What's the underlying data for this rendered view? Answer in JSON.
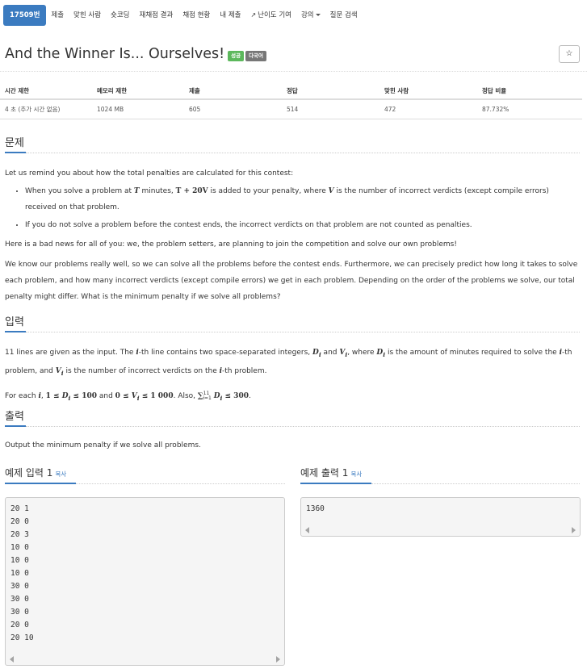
{
  "nav": {
    "items": [
      "17509번",
      "제출",
      "맞힌 사람",
      "숏코딩",
      "재채점 결과",
      "채점 현황",
      "내 제출",
      "난이도 기여",
      "강의",
      "질문 검색"
    ]
  },
  "problem": {
    "title": "And the Winner Is... Ourselves!",
    "badge_success": "성공",
    "badge_multilang": "다국어",
    "star": "☆"
  },
  "info": {
    "headers": [
      "시간 제한",
      "메모리 제한",
      "제출",
      "정답",
      "맞힌 사람",
      "정답 비율"
    ],
    "values": [
      "4 초 (추가 시간 없음)",
      "1024 MB",
      "605",
      "514",
      "472",
      "87.732%"
    ]
  },
  "sections": {
    "problem": "문제",
    "input": "입력",
    "output": "출력"
  },
  "statement": {
    "intro": "Let us remind you about how the total penalties are calculated for this contest:",
    "bullet1_a": "When you solve a problem at ",
    "bullet1_T": "T",
    "bullet1_b": " minutes, ",
    "bullet1_formula": "T + 20V",
    "bullet1_c": " is added to your penalty, where ",
    "bullet1_V": "V",
    "bullet1_d": " is the number of incorrect verdicts (except compile errors) received on that problem.",
    "bullet2": "If you do not solve a problem before the contest ends, the incorrect verdicts on that problem are not counted as penalties.",
    "para2": "Here is a bad news for all of you: we, the problem setters, are planning to join the competition and solve our own problems!",
    "para3": "We know our problems really well, so we can solve all the problems before the contest ends. Furthermore, we can precisely predict how long it takes to solve each problem, and how many incorrect verdicts (except compile errors) we get in each problem. Depending on the order of the problems we solve, our total penalty might differ. What is the minimum penalty if we solve all problems?"
  },
  "input_desc": {
    "line1_a": "11 lines are given as the input. The ",
    "line1_i": "i",
    "line1_b": "-th line contains two space-separated integers, ",
    "line1_D": "D",
    "line1_c": " and ",
    "line1_V": "V",
    "line1_d": ", where ",
    "line1_e": " is the amount of minutes required to solve the ",
    "line1_f": "-th problem, and ",
    "line1_g": " is the number of incorrect verdicts on the ",
    "line1_h": "-th problem.",
    "line2_a": "For each ",
    "line2_b": ", ",
    "line2_c1": "1 ≤ ",
    "line2_c2": " ≤ 100",
    "line2_d": " and ",
    "line2_e1": "0 ≤ ",
    "line2_e2": " ≤ 1 000",
    "line2_f": ". Also, ",
    "line2_sum": "∑",
    "line2_sum_sup": "11",
    "line2_sum_sub": "i=1",
    "line2_g": " ≤ 300",
    "line2_end": ".",
    "sub_i": "i"
  },
  "output_desc": {
    "text": "Output the minimum penalty if we solve all problems."
  },
  "samples": {
    "input_title": "예제 입력 1",
    "output_title": "예제 출력 1",
    "copy": "복사",
    "input_lines": [
      "20 1",
      "20 0",
      "20 3",
      "10 0",
      "10 0",
      "10 0",
      "30 0",
      "30 0",
      "30 0",
      "20 0",
      "20 10"
    ],
    "output_lines": [
      "1360"
    ]
  },
  "colors": {
    "accent": "#3b7bc0",
    "success": "#5cb85c",
    "gray_badge": "#777777"
  }
}
